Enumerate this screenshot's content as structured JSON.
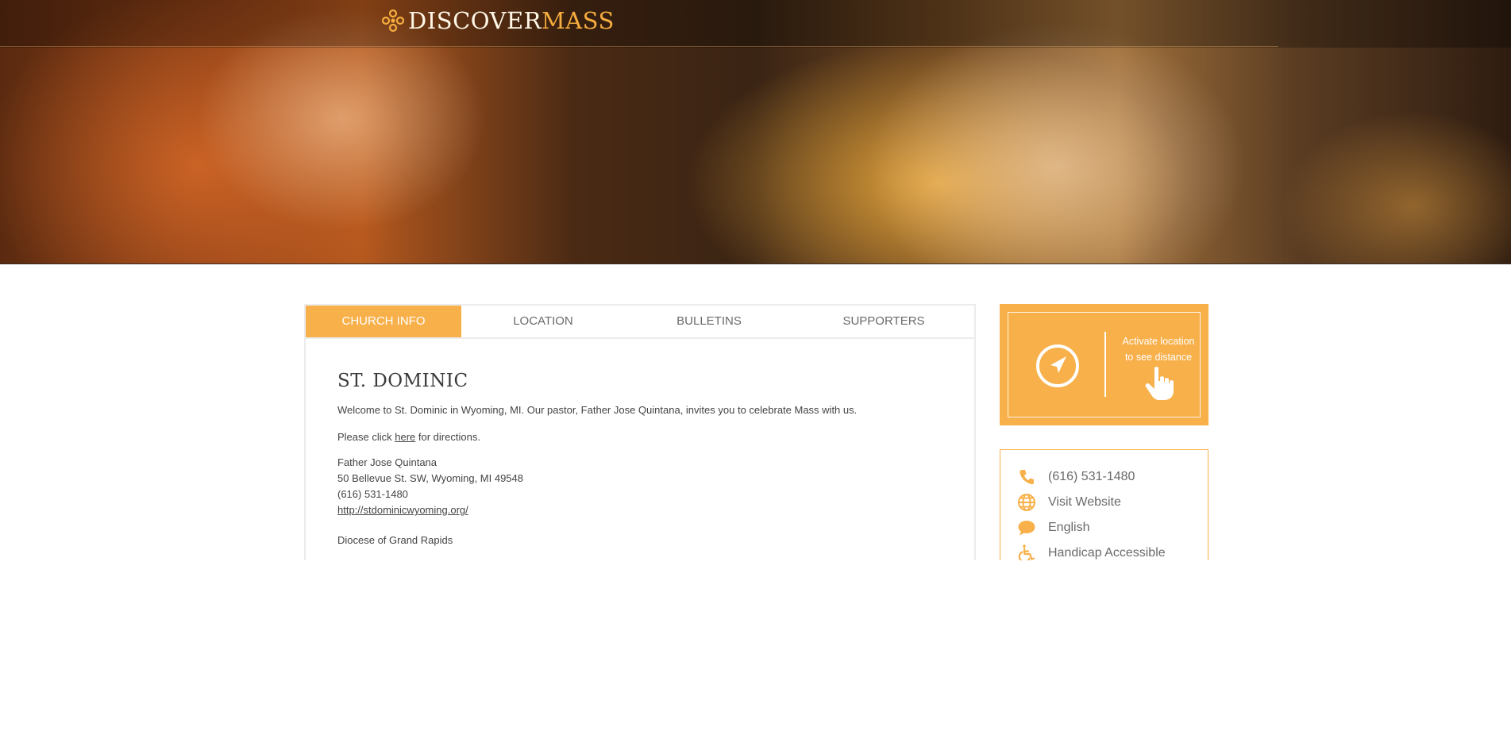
{
  "header": {
    "logo_part1": "DISCOVER",
    "logo_part2": "MASS"
  },
  "tabs": [
    {
      "label": "CHURCH INFO",
      "active": true
    },
    {
      "label": "LOCATION",
      "active": false
    },
    {
      "label": "BULLETINS",
      "active": false
    },
    {
      "label": "SUPPORTERS",
      "active": false
    }
  ],
  "church": {
    "name": "ST. DOMINIC",
    "welcome": "Welcome to St. Dominic in Wyoming, MI. Our pastor, Father Jose Quintana, invites you to celebrate Mass with us.",
    "directions_prefix": "Please click ",
    "directions_link": "here",
    "directions_suffix": " for directions.",
    "pastor": "Father Jose Quintana",
    "address": "50 Bellevue St. SW, Wyoming, MI 49548",
    "phone": "(616) 531-1480",
    "website": "http://stdominicwyoming.org/",
    "diocese": "Diocese of Grand Rapids"
  },
  "location_box": {
    "line1": "Activate location",
    "line2": "to see distance",
    "icon": "compass-icon"
  },
  "info": {
    "phone": "(616) 531-1480",
    "website_label": "Visit Website",
    "language": "English",
    "accessibility": "Handicap Accessible"
  },
  "colors": {
    "accent": "#f8b04a",
    "text": "#444444",
    "muted": "#6a6a6a",
    "border": "#ececec"
  }
}
